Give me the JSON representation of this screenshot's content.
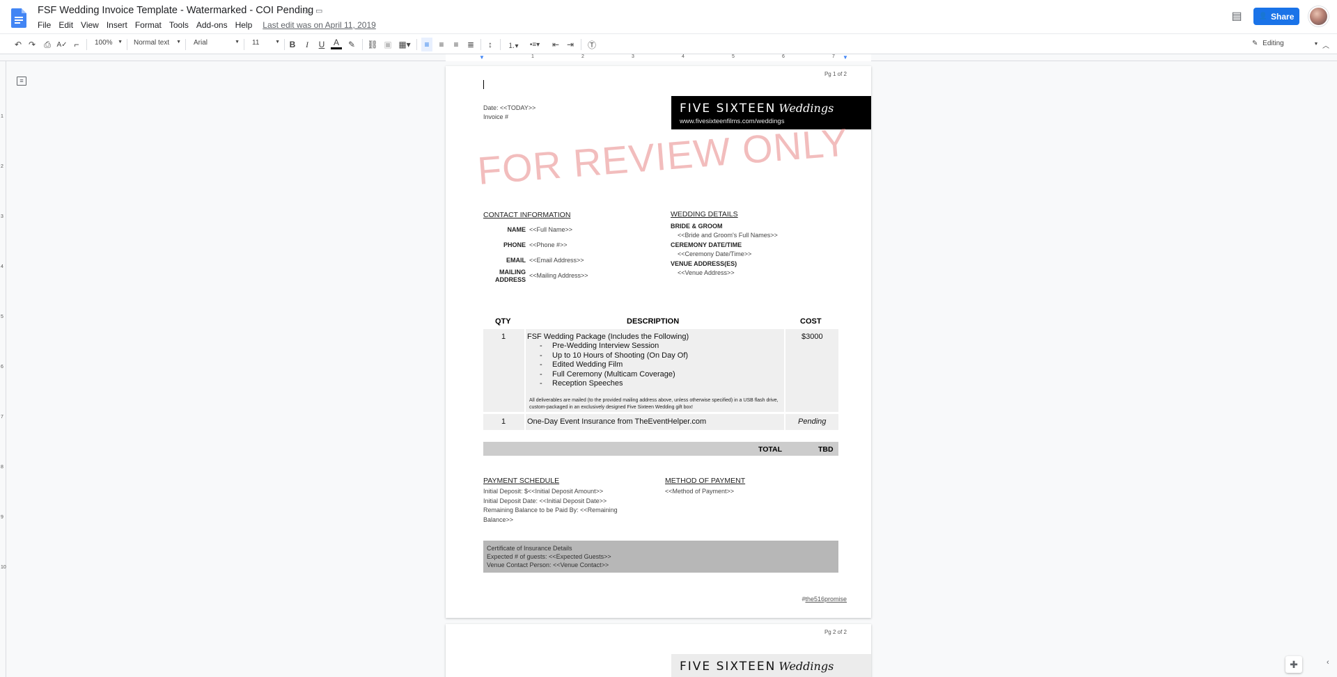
{
  "header": {
    "title": "FSF Wedding Invoice Template - Watermarked - COI Pending",
    "menu": [
      "File",
      "Edit",
      "View",
      "Insert",
      "Format",
      "Tools",
      "Add-ons",
      "Help"
    ],
    "last_edit": "Last edit was on April 11, 2019",
    "share_label": "Share"
  },
  "toolbar": {
    "zoom": "100%",
    "style": "Normal text",
    "font": "Arial",
    "size": "11",
    "mode": "Editing"
  },
  "ruler": {
    "h": [
      "1",
      "2",
      "3",
      "4",
      "5",
      "6",
      "7"
    ],
    "v": [
      "1",
      "2",
      "3",
      "4",
      "5",
      "6",
      "7",
      "8",
      "9",
      "10"
    ]
  },
  "page1": {
    "page_label": "Pg 1 of 2",
    "date_line": "Date: <<TODAY>>",
    "invoice_line": "Invoice #",
    "brand_name": "FIVE SIXTEEN",
    "brand_script": "Weddings",
    "brand_url": "www.fivesixteenfilms.com/weddings",
    "watermark": "FOR REVIEW ONLY",
    "contact_heading": "CONTACT INFORMATION",
    "contact": [
      {
        "label": "NAME",
        "value": "<<Full Name>>"
      },
      {
        "label": "PHONE",
        "value": "<<Phone #>>"
      },
      {
        "label": "EMAIL",
        "value": "<<Email Address>>"
      },
      {
        "label_line1": "MAILING",
        "label_line2": "ADDRESS",
        "value": "<<Mailing Address>>"
      }
    ],
    "wedding_heading": "WEDDING DETAILS",
    "wedding": [
      {
        "label": "BRIDE & GROOM",
        "value": "<<Bride and Groom's Full Names>>"
      },
      {
        "label": "CEREMONY DATE/TIME",
        "value": "<<Ceremony Date/Time>>"
      },
      {
        "label": "VENUE ADDRESS(ES)",
        "value": "<<Venue Address>>"
      }
    ],
    "table": {
      "headers": {
        "qty": "QTY",
        "description": "DESCRIPTION",
        "cost": "COST"
      },
      "row1": {
        "qty": "1",
        "title": "FSF Wedding Package (Includes the Following)",
        "items": [
          "Pre-Wedding Interview Session",
          "Up to 10 Hours of Shooting (On Day Of)",
          "Edited Wedding Film",
          "Full Ceremony (Multicam Coverage)",
          "Reception Speeches"
        ],
        "note": "All deliverables are mailed (to the provided mailing address above, unless otherwise specified) in a USB flash drive, custom-packaged in an exclusively designed Five Sixteen Wedding gift box!",
        "cost": "$3000"
      },
      "row2": {
        "qty": "1",
        "title": "One-Day Event Insurance from TheEventHelper.com",
        "cost": "Pending"
      },
      "total_label": "TOTAL",
      "total_value": "TBD"
    },
    "payment_heading": "PAYMENT SCHEDULE",
    "payment_lines": [
      "Initial Deposit: $<<Initial Deposit Amount>>",
      "Initial Deposit Date: <<Initial Deposit Date>>",
      "Remaining Balance to be Paid By: <<Remaining",
      "Balance>>"
    ],
    "method_heading": "METHOD OF PAYMENT",
    "method_value": "<<Method of Payment>>",
    "coi_lines": [
      "Certificate of Insurance Details",
      "Expected # of guests: <<Expected Guests>>",
      "Venue Contact Person: <<Venue Contact>>"
    ],
    "hashtag_prefix": "#",
    "hashtag_link": "the516promise"
  },
  "page2": {
    "page_label": "Pg 2 of 2",
    "brand_name": "FIVE SIXTEEN",
    "brand_script": "Weddings"
  },
  "colors": {
    "share": "#1a73e8",
    "watermark": "#e88686",
    "brand_bg": "#000000"
  }
}
